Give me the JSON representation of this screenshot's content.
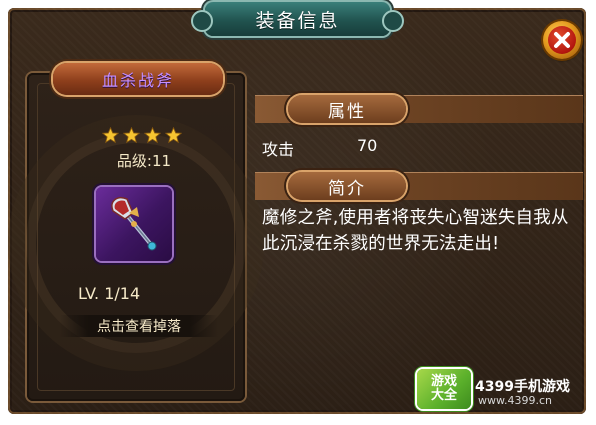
{
  "window": {
    "title": "装备信息"
  },
  "item": {
    "name": "血杀战斧",
    "stars": 4,
    "grade": "品级:11",
    "level": "LV. 1/14",
    "drop_button": "点击查看掉落"
  },
  "sections": {
    "attributes_label": "属性",
    "attack_label": "攻击",
    "attack_value": "70",
    "intro_label": "简介",
    "description": "魔修之斧,使用者将丧失心智迷失自我从此沉浸在杀戮的世界无法走出!"
  },
  "watermark": {
    "logo_line1": "游戏",
    "logo_line2": "大全",
    "brand": "4399手机游戏",
    "site": "www.4399.cn"
  },
  "colors": {
    "panel": "#2b1f15",
    "title_tab": "#21534f",
    "item_name": "#c690ff",
    "star": "#f6c531",
    "item_icon_bg": "#3c1560"
  },
  "icons": {
    "close": "close-icon",
    "star": "star-icon",
    "weapon": "axe-icon"
  }
}
